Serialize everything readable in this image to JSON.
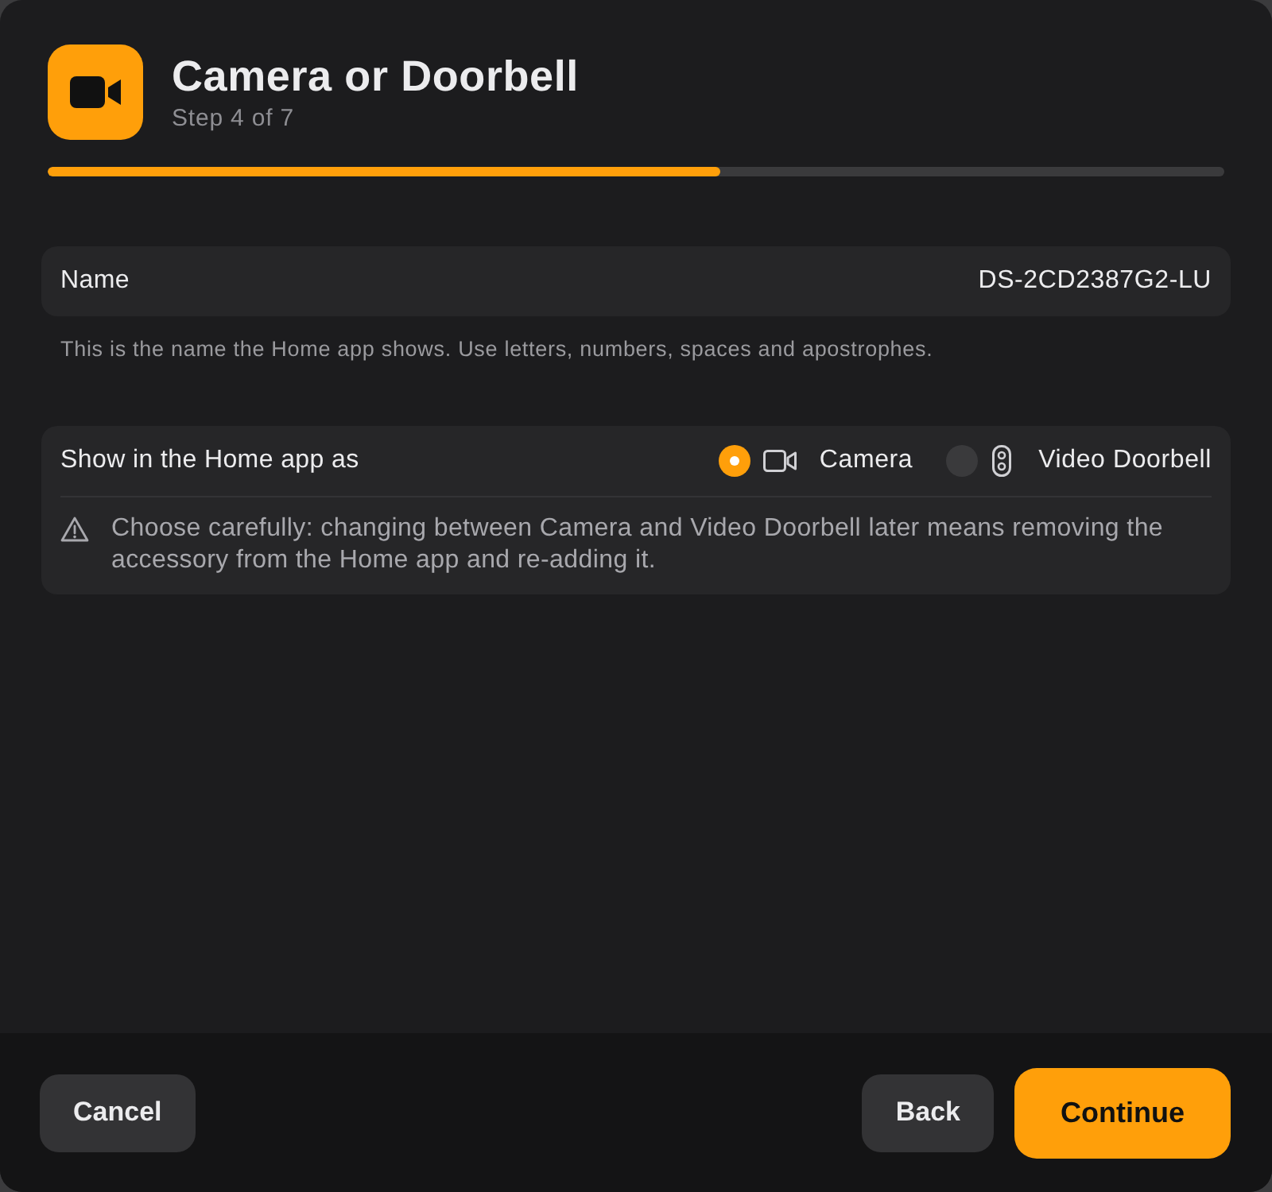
{
  "dialog": {
    "title": "Camera or Doorbell",
    "subtitle": "Step 4 of 7",
    "progress": {
      "level": 0.571
    }
  },
  "name_field": {
    "label": "Name",
    "value": "DS-2CD2387G2-LU",
    "hint": "This is the name the Home app shows. Use letters, numbers, spaces and apostrophes."
  },
  "display_as": {
    "label": "Show in the Home app as",
    "options": [
      {
        "kind": "camera",
        "label": "Camera",
        "selected": true
      },
      {
        "kind": "doorbell",
        "label": "Video Doorbell",
        "selected": false
      }
    ],
    "warning": "Choose carefully: changing between Camera and Video Doorbell later means removing the accessory from the Home app and re-adding it."
  },
  "footer": {
    "left_buttons": [
      {
        "label": "Cancel",
        "kind": "secondary"
      }
    ],
    "right_buttons": [
      {
        "label": "Back",
        "kind": "secondary"
      },
      {
        "label": "Continue",
        "kind": "primary"
      }
    ]
  }
}
